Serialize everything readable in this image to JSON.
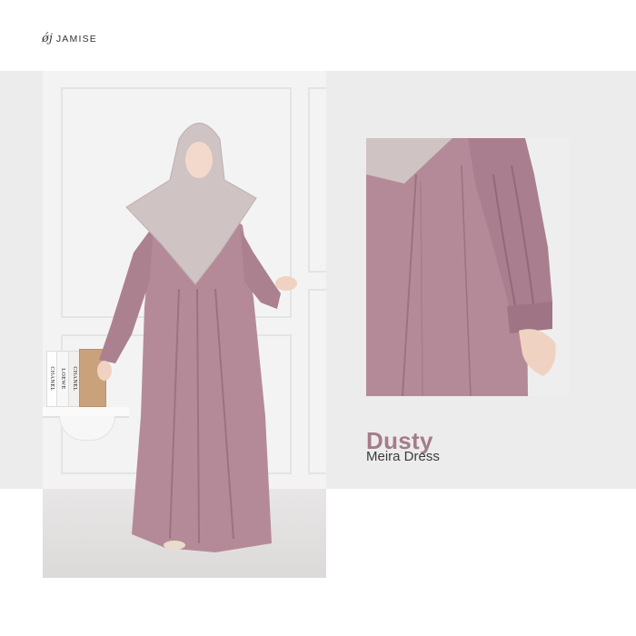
{
  "brand": {
    "mark": "ǿj",
    "name": "JAMISE"
  },
  "caption": {
    "color_name": "Dusty",
    "product_name": "Meira Dress"
  },
  "books": [
    "LOEWE",
    "CHANEL",
    "CHANEL"
  ],
  "colors": {
    "dress": "#b48a99",
    "dress_shadow": "#9c7282",
    "hijab": "#cfc3c3",
    "band": "#ececec",
    "caption_accent": "#a47c88"
  }
}
